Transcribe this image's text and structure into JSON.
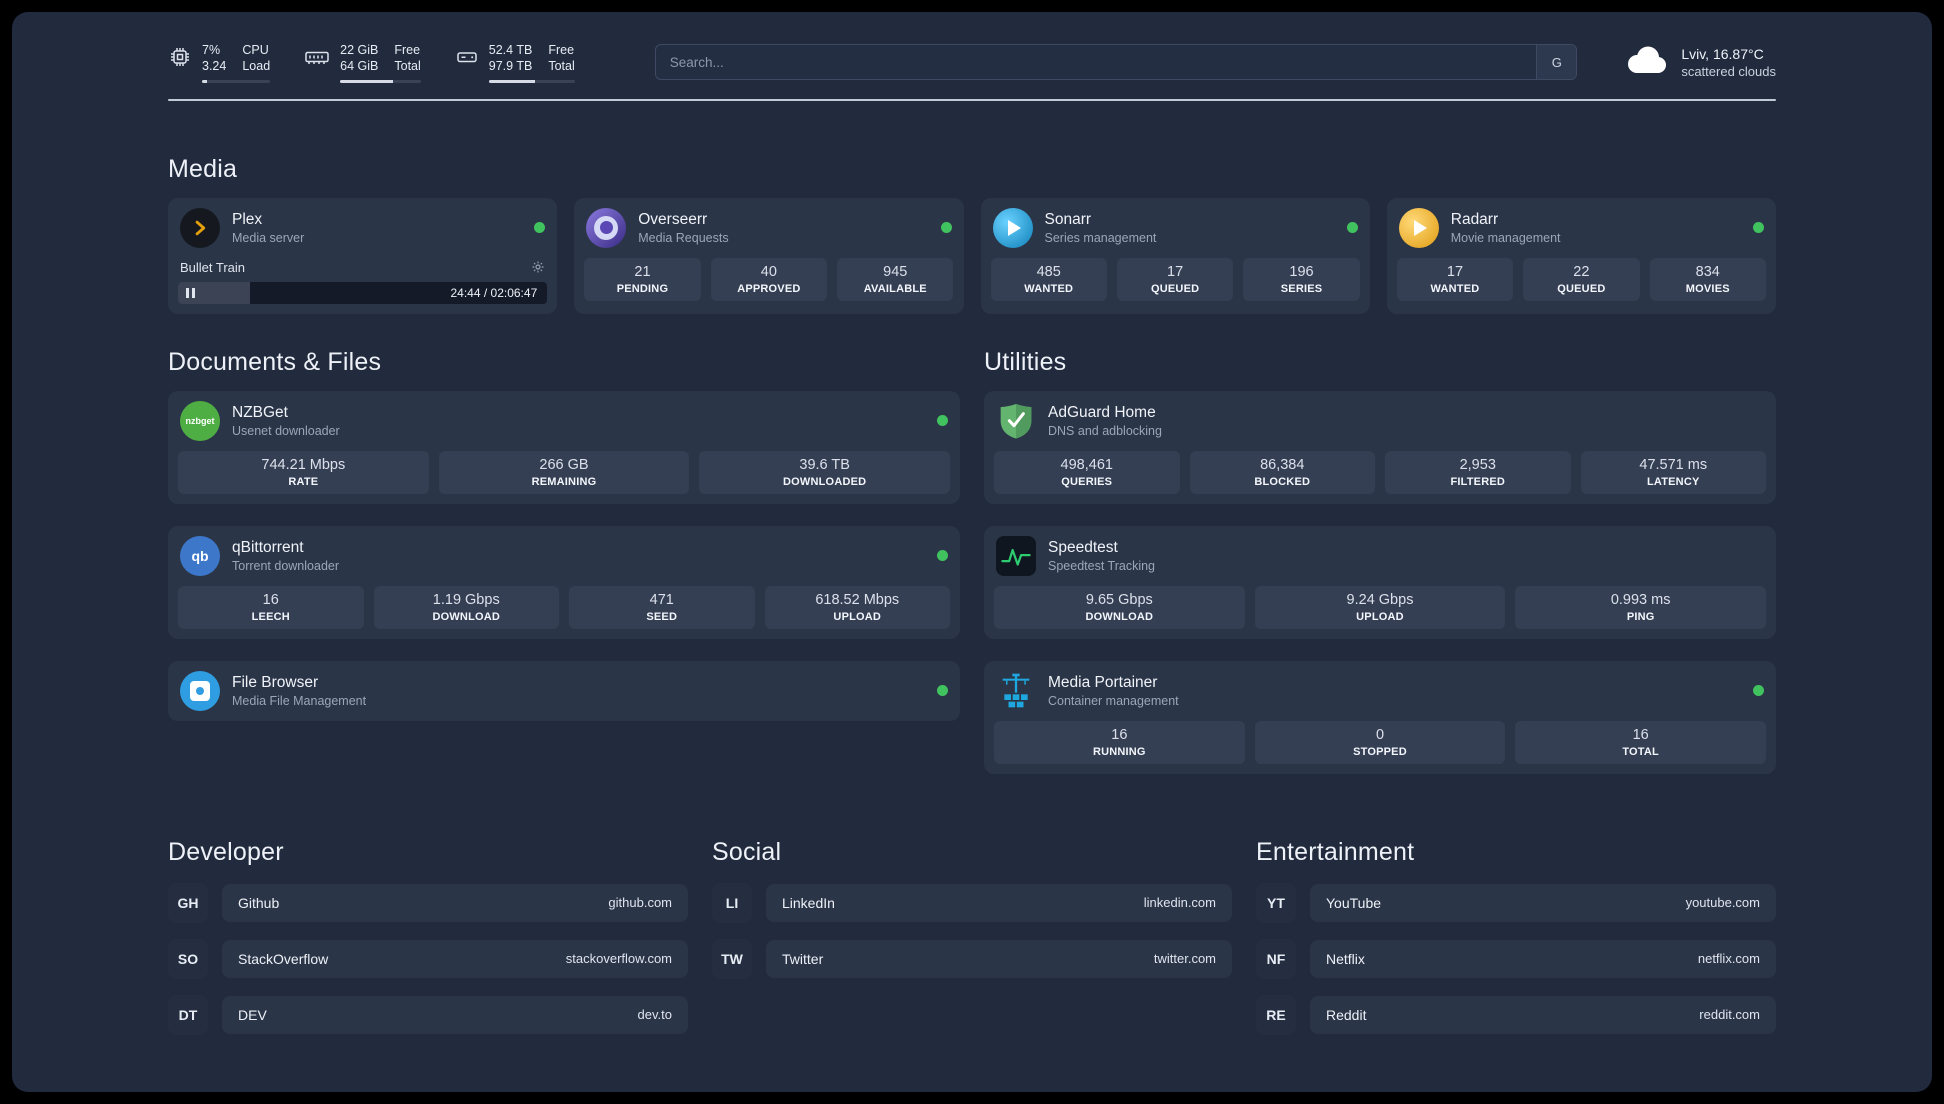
{
  "colors": {
    "panel_bg": "#212b3d",
    "card_bg": "#2b3548",
    "stat_bg": "#353f54",
    "status_online": "#40c35f",
    "plex_accent": "#e5a00d",
    "sonarr_blue": "#35c5f4",
    "radarr_amber": "#f9a825",
    "adguard_green": "#63b46e",
    "portainer_blue": "#1fa8e0",
    "speedtest_green": "#2ecc71"
  },
  "topbar": {
    "cpu": {
      "value_top": "7%",
      "value_bottom": "3.24",
      "label_top": "CPU",
      "label_bottom": "Load",
      "progress": 7
    },
    "ram": {
      "value_top": "22 GiB",
      "value_bottom": "64 GiB",
      "label_top": "Free",
      "label_bottom": "Total",
      "progress": 66
    },
    "disk": {
      "value_top": "52.4 TB",
      "value_bottom": "97.9 TB",
      "label_top": "Free",
      "label_bottom": "Total",
      "progress": 54
    },
    "search": {
      "placeholder": "Search...",
      "button_label": "G"
    },
    "weather": {
      "location": "Lviv, 16.87°C",
      "condition": "scattered clouds"
    }
  },
  "icons": {
    "nzbget_text": "nzbget",
    "qbittorrent_text": "qb"
  },
  "sections": {
    "media": {
      "title": "Media",
      "plex": {
        "title": "Plex",
        "subtitle": "Media server",
        "now_playing": "Bullet Train",
        "time": "24:44 / 02:06:47",
        "progress": 19.5
      },
      "overseerr": {
        "title": "Overseerr",
        "subtitle": "Media Requests",
        "stats": [
          {
            "value": "21",
            "label": "PENDING"
          },
          {
            "value": "40",
            "label": "APPROVED"
          },
          {
            "value": "945",
            "label": "AVAILABLE"
          }
        ]
      },
      "sonarr": {
        "title": "Sonarr",
        "subtitle": "Series management",
        "stats": [
          {
            "value": "485",
            "label": "WANTED"
          },
          {
            "value": "17",
            "label": "QUEUED"
          },
          {
            "value": "196",
            "label": "SERIES"
          }
        ]
      },
      "radarr": {
        "title": "Radarr",
        "subtitle": "Movie management",
        "stats": [
          {
            "value": "17",
            "label": "WANTED"
          },
          {
            "value": "22",
            "label": "QUEUED"
          },
          {
            "value": "834",
            "label": "MOVIES"
          }
        ]
      }
    },
    "documents": {
      "title": "Documents & Files",
      "nzbget": {
        "title": "NZBGet",
        "subtitle": "Usenet downloader",
        "stats": [
          {
            "value": "744.21 Mbps",
            "label": "RATE"
          },
          {
            "value": "266 GB",
            "label": "REMAINING"
          },
          {
            "value": "39.6 TB",
            "label": "DOWNLOADED"
          }
        ]
      },
      "qbittorrent": {
        "title": "qBittorrent",
        "subtitle": "Torrent downloader",
        "stats": [
          {
            "value": "16",
            "label": "LEECH"
          },
          {
            "value": "1.19 Gbps",
            "label": "DOWNLOAD"
          },
          {
            "value": "471",
            "label": "SEED"
          },
          {
            "value": "618.52 Mbps",
            "label": "UPLOAD"
          }
        ]
      },
      "filebrowser": {
        "title": "File Browser",
        "subtitle": "Media File Management"
      }
    },
    "utilities": {
      "title": "Utilities",
      "adguard": {
        "title": "AdGuard Home",
        "subtitle": "DNS and adblocking",
        "stats": [
          {
            "value": "498,461",
            "label": "QUERIES"
          },
          {
            "value": "86,384",
            "label": "BLOCKED"
          },
          {
            "value": "2,953",
            "label": "FILTERED"
          },
          {
            "value": "47.571 ms",
            "label": "LATENCY"
          }
        ]
      },
      "speedtest": {
        "title": "Speedtest",
        "subtitle": "Speedtest Tracking",
        "stats": [
          {
            "value": "9.65 Gbps",
            "label": "DOWNLOAD"
          },
          {
            "value": "9.24 Gbps",
            "label": "UPLOAD"
          },
          {
            "value": "0.993 ms",
            "label": "PING"
          }
        ]
      },
      "portainer": {
        "title": "Media Portainer",
        "subtitle": "Container management",
        "stats": [
          {
            "value": "16",
            "label": "RUNNING"
          },
          {
            "value": "0",
            "label": "STOPPED"
          },
          {
            "value": "16",
            "label": "TOTAL"
          }
        ]
      }
    },
    "links": [
      {
        "title": "Developer",
        "items": [
          {
            "abbr": "GH",
            "name": "Github",
            "domain": "github.com"
          },
          {
            "abbr": "SO",
            "name": "StackOverflow",
            "domain": "stackoverflow.com"
          },
          {
            "abbr": "DT",
            "name": "DEV",
            "domain": "dev.to"
          }
        ]
      },
      {
        "title": "Social",
        "items": [
          {
            "abbr": "LI",
            "name": "LinkedIn",
            "domain": "linkedin.com"
          },
          {
            "abbr": "TW",
            "name": "Twitter",
            "domain": "twitter.com"
          }
        ]
      },
      {
        "title": "Entertainment",
        "items": [
          {
            "abbr": "YT",
            "name": "YouTube",
            "domain": "youtube.com"
          },
          {
            "abbr": "NF",
            "name": "Netflix",
            "domain": "netflix.com"
          },
          {
            "abbr": "RE",
            "name": "Reddit",
            "domain": "reddit.com"
          }
        ]
      }
    ]
  }
}
